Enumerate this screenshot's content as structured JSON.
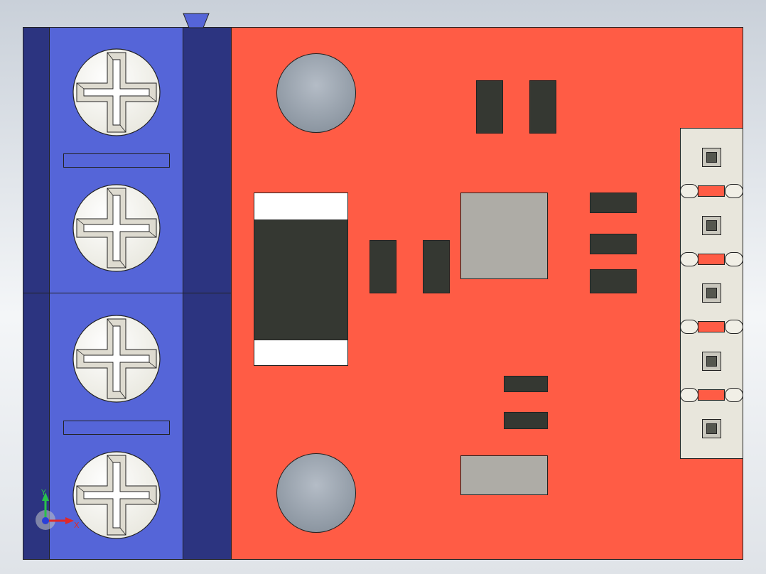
{
  "scene": {
    "colors": {
      "background_top": "#c9d0d9",
      "background_bottom": "#f4f6f8",
      "terminal_block_dark": "#2c3480",
      "terminal_block_light": "#5565d8",
      "pcb": "#ff5c45",
      "outline": "#222222",
      "component_dark": "#353832",
      "component_gray": "#aeaca6",
      "pad_white": "#ffffff",
      "mounting_hole": "#9aa3ad",
      "header_pin": "#e8e6dc"
    },
    "screw_terminals": [
      {
        "name": "screw-1",
        "icon": "phillips-screw-icon"
      },
      {
        "name": "screw-2",
        "icon": "phillips-screw-icon"
      },
      {
        "name": "screw-3",
        "icon": "phillips-screw-icon"
      },
      {
        "name": "screw-4",
        "icon": "phillips-screw-icon"
      }
    ],
    "header_pins": [
      {
        "name": "pin-1"
      },
      {
        "name": "pin-2"
      },
      {
        "name": "pin-3"
      },
      {
        "name": "pin-4"
      },
      {
        "name": "pin-5"
      }
    ],
    "axis_triad": {
      "y_label": "Y",
      "x_label": "X",
      "y_color": "#27c24a",
      "x_color": "#e02828",
      "z_color": "#2a3fd8"
    }
  }
}
